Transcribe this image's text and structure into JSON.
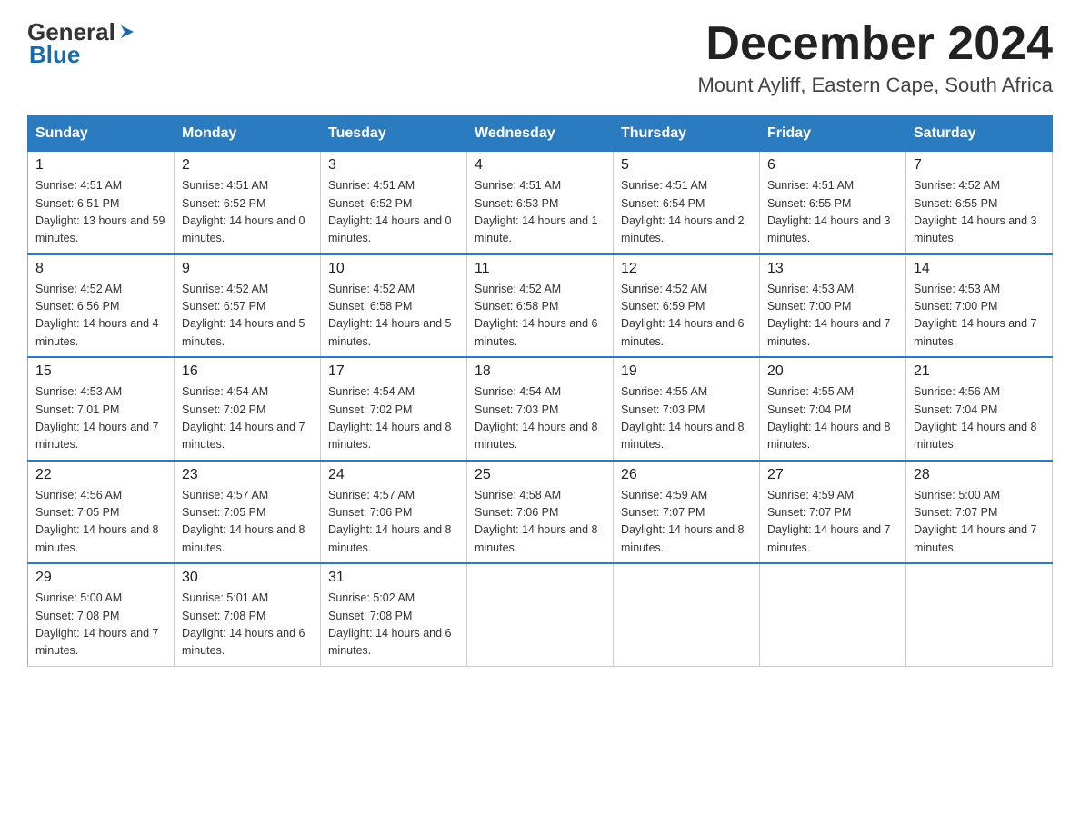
{
  "header": {
    "logo_general": "General",
    "logo_blue": "Blue",
    "month_title": "December 2024",
    "location": "Mount Ayliff, Eastern Cape, South Africa"
  },
  "weekdays": [
    "Sunday",
    "Monday",
    "Tuesday",
    "Wednesday",
    "Thursday",
    "Friday",
    "Saturday"
  ],
  "weeks": [
    [
      {
        "day": "1",
        "sunrise": "4:51 AM",
        "sunset": "6:51 PM",
        "daylight": "13 hours and 59 minutes."
      },
      {
        "day": "2",
        "sunrise": "4:51 AM",
        "sunset": "6:52 PM",
        "daylight": "14 hours and 0 minutes."
      },
      {
        "day": "3",
        "sunrise": "4:51 AM",
        "sunset": "6:52 PM",
        "daylight": "14 hours and 0 minutes."
      },
      {
        "day": "4",
        "sunrise": "4:51 AM",
        "sunset": "6:53 PM",
        "daylight": "14 hours and 1 minute."
      },
      {
        "day": "5",
        "sunrise": "4:51 AM",
        "sunset": "6:54 PM",
        "daylight": "14 hours and 2 minutes."
      },
      {
        "day": "6",
        "sunrise": "4:51 AM",
        "sunset": "6:55 PM",
        "daylight": "14 hours and 3 minutes."
      },
      {
        "day": "7",
        "sunrise": "4:52 AM",
        "sunset": "6:55 PM",
        "daylight": "14 hours and 3 minutes."
      }
    ],
    [
      {
        "day": "8",
        "sunrise": "4:52 AM",
        "sunset": "6:56 PM",
        "daylight": "14 hours and 4 minutes."
      },
      {
        "day": "9",
        "sunrise": "4:52 AM",
        "sunset": "6:57 PM",
        "daylight": "14 hours and 5 minutes."
      },
      {
        "day": "10",
        "sunrise": "4:52 AM",
        "sunset": "6:58 PM",
        "daylight": "14 hours and 5 minutes."
      },
      {
        "day": "11",
        "sunrise": "4:52 AM",
        "sunset": "6:58 PM",
        "daylight": "14 hours and 6 minutes."
      },
      {
        "day": "12",
        "sunrise": "4:52 AM",
        "sunset": "6:59 PM",
        "daylight": "14 hours and 6 minutes."
      },
      {
        "day": "13",
        "sunrise": "4:53 AM",
        "sunset": "7:00 PM",
        "daylight": "14 hours and 7 minutes."
      },
      {
        "day": "14",
        "sunrise": "4:53 AM",
        "sunset": "7:00 PM",
        "daylight": "14 hours and 7 minutes."
      }
    ],
    [
      {
        "day": "15",
        "sunrise": "4:53 AM",
        "sunset": "7:01 PM",
        "daylight": "14 hours and 7 minutes."
      },
      {
        "day": "16",
        "sunrise": "4:54 AM",
        "sunset": "7:02 PM",
        "daylight": "14 hours and 7 minutes."
      },
      {
        "day": "17",
        "sunrise": "4:54 AM",
        "sunset": "7:02 PM",
        "daylight": "14 hours and 8 minutes."
      },
      {
        "day": "18",
        "sunrise": "4:54 AM",
        "sunset": "7:03 PM",
        "daylight": "14 hours and 8 minutes."
      },
      {
        "day": "19",
        "sunrise": "4:55 AM",
        "sunset": "7:03 PM",
        "daylight": "14 hours and 8 minutes."
      },
      {
        "day": "20",
        "sunrise": "4:55 AM",
        "sunset": "7:04 PM",
        "daylight": "14 hours and 8 minutes."
      },
      {
        "day": "21",
        "sunrise": "4:56 AM",
        "sunset": "7:04 PM",
        "daylight": "14 hours and 8 minutes."
      }
    ],
    [
      {
        "day": "22",
        "sunrise": "4:56 AM",
        "sunset": "7:05 PM",
        "daylight": "14 hours and 8 minutes."
      },
      {
        "day": "23",
        "sunrise": "4:57 AM",
        "sunset": "7:05 PM",
        "daylight": "14 hours and 8 minutes."
      },
      {
        "day": "24",
        "sunrise": "4:57 AM",
        "sunset": "7:06 PM",
        "daylight": "14 hours and 8 minutes."
      },
      {
        "day": "25",
        "sunrise": "4:58 AM",
        "sunset": "7:06 PM",
        "daylight": "14 hours and 8 minutes."
      },
      {
        "day": "26",
        "sunrise": "4:59 AM",
        "sunset": "7:07 PM",
        "daylight": "14 hours and 8 minutes."
      },
      {
        "day": "27",
        "sunrise": "4:59 AM",
        "sunset": "7:07 PM",
        "daylight": "14 hours and 7 minutes."
      },
      {
        "day": "28",
        "sunrise": "5:00 AM",
        "sunset": "7:07 PM",
        "daylight": "14 hours and 7 minutes."
      }
    ],
    [
      {
        "day": "29",
        "sunrise": "5:00 AM",
        "sunset": "7:08 PM",
        "daylight": "14 hours and 7 minutes."
      },
      {
        "day": "30",
        "sunrise": "5:01 AM",
        "sunset": "7:08 PM",
        "daylight": "14 hours and 6 minutes."
      },
      {
        "day": "31",
        "sunrise": "5:02 AM",
        "sunset": "7:08 PM",
        "daylight": "14 hours and 6 minutes."
      },
      null,
      null,
      null,
      null
    ]
  ]
}
